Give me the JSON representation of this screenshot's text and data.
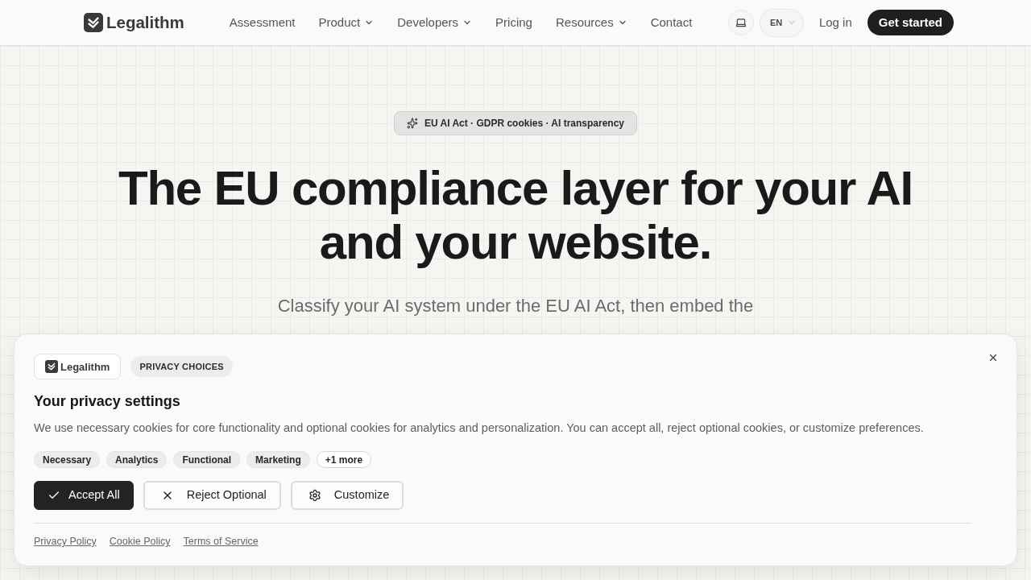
{
  "nav": {
    "logo": "Legalithm",
    "links": [
      {
        "label": "Assessment",
        "kind": "link"
      },
      {
        "label": "Product",
        "kind": "menu"
      },
      {
        "label": "Developers",
        "kind": "menu"
      },
      {
        "label": "Pricing",
        "kind": "link"
      },
      {
        "label": "Resources",
        "kind": "menu"
      },
      {
        "label": "Contact",
        "kind": "link"
      }
    ],
    "language": "EN",
    "login": "Log in",
    "cta": "Get started"
  },
  "hero": {
    "badge": "EU AI Act · GDPR cookies · AI transparency",
    "title": "The EU compliance layer for your AI and your website.",
    "subtitle": "Classify your AI system under the EU AI Act, then embed the"
  },
  "cookie_banner": {
    "logo": "Legalithm",
    "tag": "PRIVACY CHOICES",
    "title": "Your privacy settings",
    "description": "We use necessary cookies for core functionality and optional cookies for analytics and personalization. You can accept all, reject optional cookies, or customize preferences.",
    "categories": [
      {
        "label": "Necessary",
        "kind": "category"
      },
      {
        "label": "Analytics",
        "kind": "category"
      },
      {
        "label": "Functional",
        "kind": "category"
      },
      {
        "label": "Marketing",
        "kind": "category"
      },
      {
        "label": "+1 more",
        "kind": "more"
      }
    ],
    "buttons": [
      {
        "label": "Accept All",
        "kind": "accept"
      },
      {
        "label": "Reject Optional",
        "kind": "reject"
      },
      {
        "label": "Customize",
        "kind": "customize"
      }
    ],
    "links": [
      "Privacy Policy",
      "Cookie Policy",
      "Terms of Service"
    ]
  }
}
